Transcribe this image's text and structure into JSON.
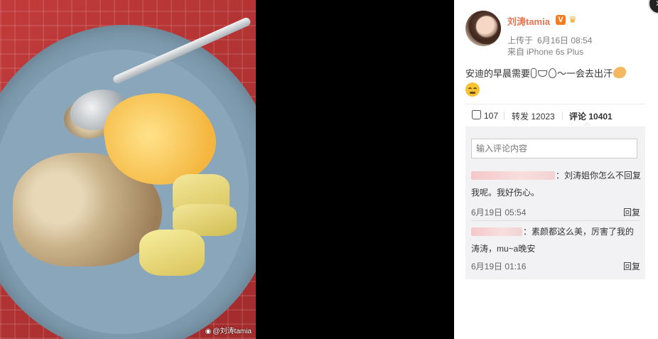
{
  "photo": {
    "watermark_text": "@刘涛tamia",
    "watermark_icon": "weibo-icon"
  },
  "post": {
    "username": "刘涛tamia",
    "verified_badge": "V",
    "timestamp_label": "上传于",
    "timestamp": "6月16日 08:54",
    "source_label": "来自",
    "source": "iPhone 6s Plus",
    "text_part1": "安迪的早晨需要",
    "text_part2": "～一会去出汗",
    "accent_color": "#eb7350"
  },
  "actions": {
    "likes": "107",
    "repost_label": "转发",
    "repost_count": "12023",
    "comment_label": "评论",
    "comment_count": "10401"
  },
  "comments": {
    "input_placeholder": "输入评论内容",
    "items": [
      {
        "text_line1": "：刘涛姐你怎么不回复",
        "text_line2": "我呢。我好伤心。",
        "time": "6月19日 05:54",
        "reply_label": "回复"
      },
      {
        "text_line1": "：素颜都这么美，厉害了我的",
        "text_line2": "涛涛，mu~a晚安",
        "time": "6月19日 01:16",
        "reply_label": "回复"
      }
    ]
  }
}
